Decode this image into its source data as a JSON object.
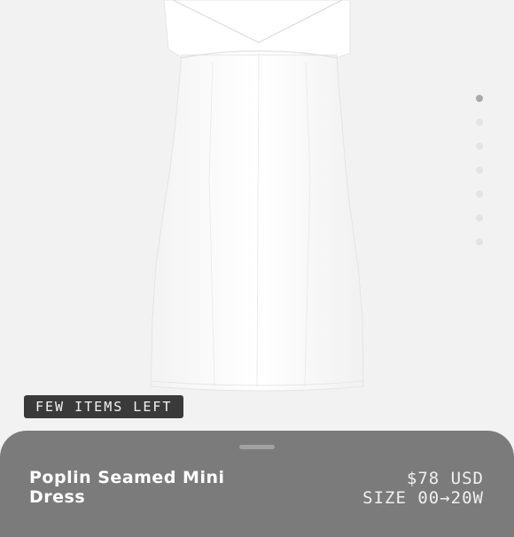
{
  "gallery": {
    "slide_count": 7,
    "active_index": 0
  },
  "badge": {
    "label": "FEW ITEMS LEFT"
  },
  "product": {
    "name": "Poplin Seamed Mini Dress",
    "price": "$78 USD",
    "size_range": "SIZE 00→20W"
  },
  "colors": {
    "background": "#f2f2f2",
    "sheet": "#7b7b7b",
    "badge": "#3a3a3a",
    "dot_active": "#a9a9a9",
    "dot_inactive": "#e3e3e3"
  }
}
